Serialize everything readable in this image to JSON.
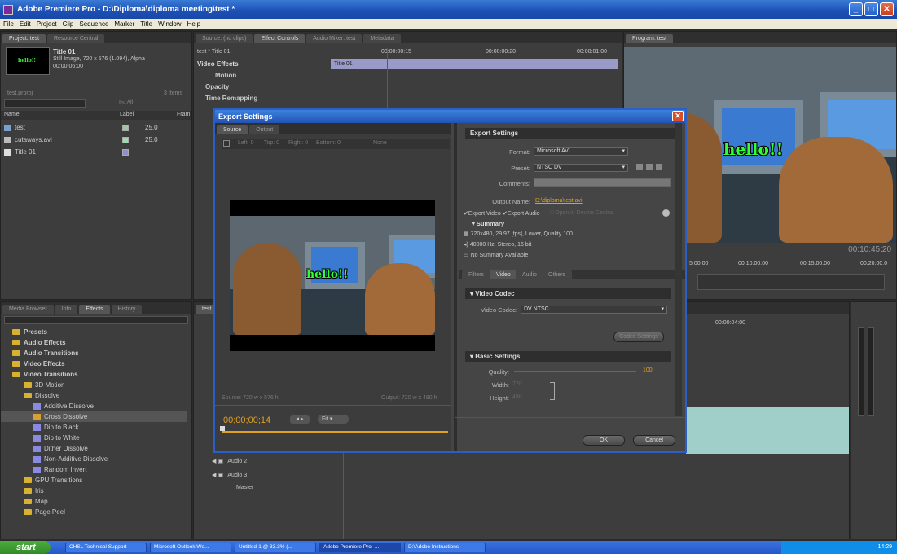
{
  "window": {
    "title": "Adobe Premiere Pro - D:\\Diploma\\diploma meeting\\test *"
  },
  "menu": [
    "File",
    "Edit",
    "Project",
    "Clip",
    "Sequence",
    "Marker",
    "Title",
    "Window",
    "Help"
  ],
  "project": {
    "tabs": [
      "Project: test",
      "Resource Central"
    ],
    "clip_name": "Title 01",
    "clip_info": "Still Image, 720 x 576 (1.094), Alpha",
    "clip_duration": "00:00:06:00",
    "thumb_text": "hello!!",
    "project_file": "test.prproj",
    "item_count": "3 Items",
    "search_in": "In: All",
    "columns": [
      "Name",
      "Label",
      "Fram"
    ],
    "items": [
      {
        "name": "test",
        "fps": "25.0",
        "color": "#a0c8a0"
      },
      {
        "name": "cutaways.avi",
        "fps": "25.0",
        "color": "#a0d8b0"
      },
      {
        "name": "Title 01",
        "fps": "",
        "color": "#9090d0"
      }
    ]
  },
  "effect_controls": {
    "tabs": [
      "Source: (no clips)",
      "Effect Controls",
      "Audio Mixer: test",
      "Metadata"
    ],
    "sequence": "test * Title 01",
    "times": [
      "00:00:00:15",
      "00:00:00:20",
      "00:00:01:00"
    ],
    "clip_bar": "Title 01",
    "section": "Video Effects",
    "effects": [
      "Motion",
      "Opacity",
      "Time Remapping"
    ]
  },
  "program": {
    "tab": "Program: test",
    "timecode": "00:10:45:20",
    "ruler": [
      "5:00:00",
      "00:10:00:00",
      "00:15:00:00",
      "00:20:00:0"
    ],
    "overlay": "hello!!"
  },
  "effects_panel": {
    "tabs": [
      "Media Browser",
      "Info",
      "Effects",
      "History"
    ],
    "tree": [
      {
        "label": "Presets",
        "level": 0,
        "bold": true
      },
      {
        "label": "Audio Effects",
        "level": 0,
        "bold": true
      },
      {
        "label": "Audio Transitions",
        "level": 0,
        "bold": true
      },
      {
        "label": "Video Effects",
        "level": 0,
        "bold": true
      },
      {
        "label": "Video Transitions",
        "level": 0,
        "bold": true
      },
      {
        "label": "3D Motion",
        "level": 1
      },
      {
        "label": "Dissolve",
        "level": 1
      },
      {
        "label": "Additive Dissolve",
        "level": 2
      },
      {
        "label": "Cross Dissolve",
        "level": 2,
        "selected": true
      },
      {
        "label": "Dip to Black",
        "level": 2
      },
      {
        "label": "Dip to White",
        "level": 2
      },
      {
        "label": "Dither Dissolve",
        "level": 2
      },
      {
        "label": "Non-Additive Dissolve",
        "level": 2
      },
      {
        "label": "Random Invert",
        "level": 2
      },
      {
        "label": "GPU Transitions",
        "level": 1
      },
      {
        "label": "Iris",
        "level": 1
      },
      {
        "label": "Map",
        "level": 1
      },
      {
        "label": "Page Peel",
        "level": 1
      }
    ]
  },
  "timeline": {
    "time": "00:00:04:00",
    "tracks": [
      "Audio 2",
      "Audio 3",
      "Master"
    ]
  },
  "dialog": {
    "title": "Export Settings",
    "tabs": [
      "Source",
      "Output"
    ],
    "crop_labels": [
      "Left: 0",
      "Top: 0",
      "Right: 0",
      "Bottom: 0"
    ],
    "crop_none": "None",
    "source_info": "Source: 720 w x 576 h",
    "output_info": "Output: 720 w x 480 h",
    "overlay": "hello!!",
    "timecode": "00;00;00;14",
    "fit": "Fit",
    "export_settings": {
      "header": "Export Settings",
      "format_label": "Format:",
      "format": "Microsoft AVI",
      "preset_label": "Preset:",
      "preset": "NTSC DV",
      "comments_label": "Comments:",
      "output_name_label": "Output Name:",
      "output_name": "D:\\diploma\\test.avi",
      "export_video": "Export Video",
      "export_audio": "Export Audio",
      "device_control": "Open in Device Central",
      "summary_header": "Summary",
      "summary": [
        "720x480, 29.97 [fps], Lower, Quality 100",
        "48000 Hz, Stereo, 16 bit",
        "No Summary Available"
      ]
    },
    "settings_tabs": [
      "Filters",
      "Video",
      "Audio",
      "Others"
    ],
    "video_codec": {
      "header": "Video Codec",
      "label": "Video Codec:",
      "value": "DV NTSC",
      "button": "Codec Settings"
    },
    "basic": {
      "header": "Basic Settings",
      "quality_label": "Quality:",
      "quality": "100",
      "width_label": "Width:",
      "width": "720",
      "height_label": "Height:",
      "height": "480"
    },
    "ok": "OK",
    "cancel": "Cancel"
  },
  "taskbar": {
    "start": "start",
    "items": [
      "CHSL Technical Support",
      "Microsoft Outlook We...",
      "Untitled-1 @ 33.3% (...",
      "Adobe Premiere Pro -...",
      "D:\\Adobe Instructions"
    ],
    "clock": "14:29"
  }
}
